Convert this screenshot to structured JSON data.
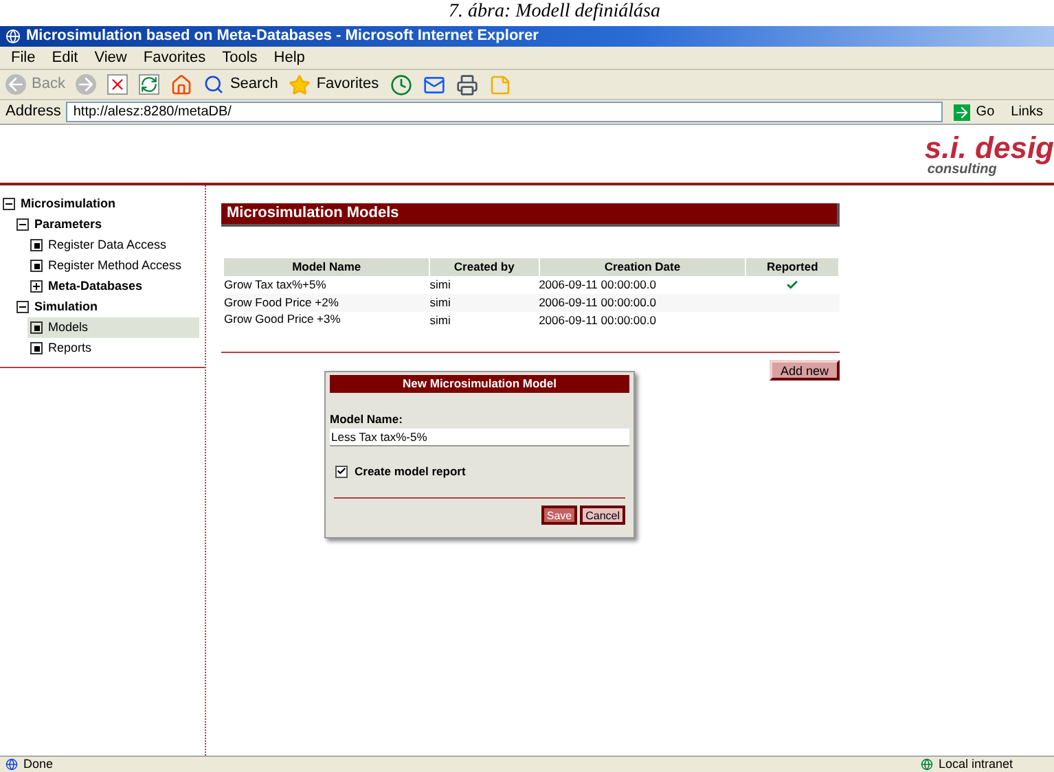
{
  "caption": "7. ábra: Modell definiálása",
  "window": {
    "title": "Microsimulation based on Meta-Databases - Microsoft Internet Explorer"
  },
  "menu": [
    "File",
    "Edit",
    "View",
    "Favorites",
    "Tools",
    "Help"
  ],
  "toolbar": {
    "back": "Back",
    "search": "Search",
    "favorites": "Favorites"
  },
  "address": {
    "label": "Address",
    "value": "http://alesz:8280/metaDB/",
    "go": "Go",
    "links": "Links"
  },
  "logo": {
    "name": "s.i. desig",
    "tagline": "consulting"
  },
  "sidebar": {
    "items": [
      {
        "label": "Microsimulation",
        "bold": true,
        "expanded": true,
        "selected": false,
        "children": [
          {
            "label": "Parameters",
            "bold": true,
            "expanded": true,
            "selected": false,
            "children": [
              {
                "label": "Register Data Access",
                "bold": false,
                "expanded": false,
                "selected": false
              },
              {
                "label": "Register Method Access",
                "bold": false,
                "expanded": false,
                "selected": false
              },
              {
                "label": "Meta-Databases",
                "bold": true,
                "expanded": false,
                "selected": false
              }
            ]
          },
          {
            "label": "Simulation",
            "bold": true,
            "expanded": true,
            "selected": false,
            "children": [
              {
                "label": "Models",
                "bold": false,
                "expanded": false,
                "selected": true
              },
              {
                "label": "Reports",
                "bold": false,
                "expanded": false,
                "selected": false
              }
            ]
          }
        ]
      }
    ]
  },
  "panel": {
    "title": "Microsimulation Models"
  },
  "table": {
    "columns": [
      "Model Name",
      "Created by",
      "Creation Date",
      "Reported"
    ],
    "rows": [
      {
        "name": "Grow Tax tax%+5%",
        "created_by": "simi",
        "date": "2006-09-11 00:00:00.0",
        "reported": true
      },
      {
        "name": "Grow Food Price +2%",
        "created_by": "simi",
        "date": "2006-09-11 00:00:00.0",
        "reported": false
      },
      {
        "name": "Grow Good Price +3%",
        "created_by": "simi",
        "date": "2006-09-11 00:00:00.0",
        "reported": false
      }
    ]
  },
  "add_button": "Add new",
  "dialog": {
    "title": "New Microsimulation Model",
    "field_label": "Model Name:",
    "value": "Less Tax tax%-5%",
    "checkbox": {
      "label": "Create model report",
      "checked": true
    },
    "buttons": [
      "Save",
      "Cancel"
    ]
  },
  "status_bar": {
    "text": "Done",
    "zone": "Local intranet"
  }
}
